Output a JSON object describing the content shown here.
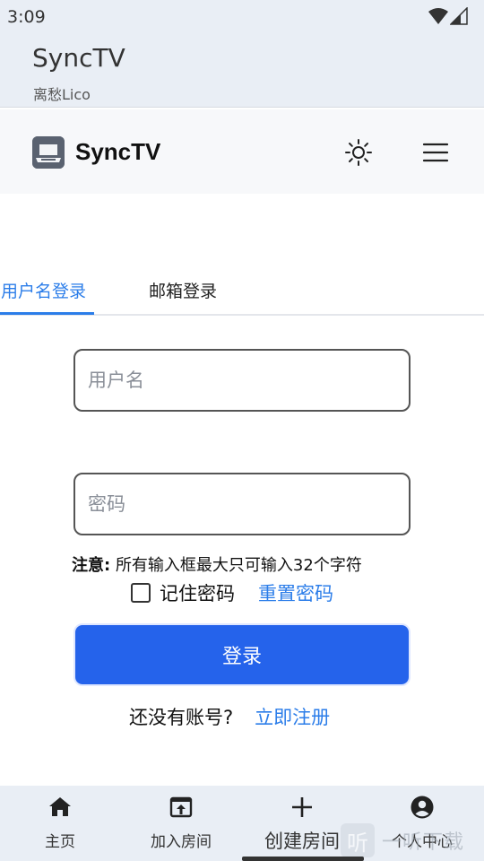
{
  "status_bar": {
    "time": "3:09"
  },
  "app_header": {
    "title": "SyncTV",
    "subtitle": "离愁Lico"
  },
  "navbar": {
    "brand": "SyncTV"
  },
  "tabs": [
    {
      "label": "用户名登录",
      "active": true
    },
    {
      "label": "邮箱登录",
      "active": false
    }
  ],
  "form": {
    "username_placeholder": "用户名",
    "password_placeholder": "密码",
    "note_label": "注意:",
    "note_text": "所有输入框最大只可输入32个字符",
    "remember_label": "记住密码",
    "remember_checked": false,
    "reset_link": "重置密码",
    "login_button": "登录",
    "signup_prompt": "还没有账号?",
    "signup_link": "立即注册"
  },
  "bottom_nav": [
    {
      "label": "主页",
      "icon": "home-icon"
    },
    {
      "label": "加入房间",
      "icon": "join-room-icon"
    },
    {
      "label": "创建房间",
      "icon": "plus-icon"
    },
    {
      "label": "个人中心",
      "icon": "account-icon"
    }
  ],
  "watermark": {
    "badge": "听",
    "text": "一听下载"
  },
  "colors": {
    "accent": "#2b7de9",
    "primary_button": "#2563eb",
    "header_bg": "#e9eef5"
  }
}
